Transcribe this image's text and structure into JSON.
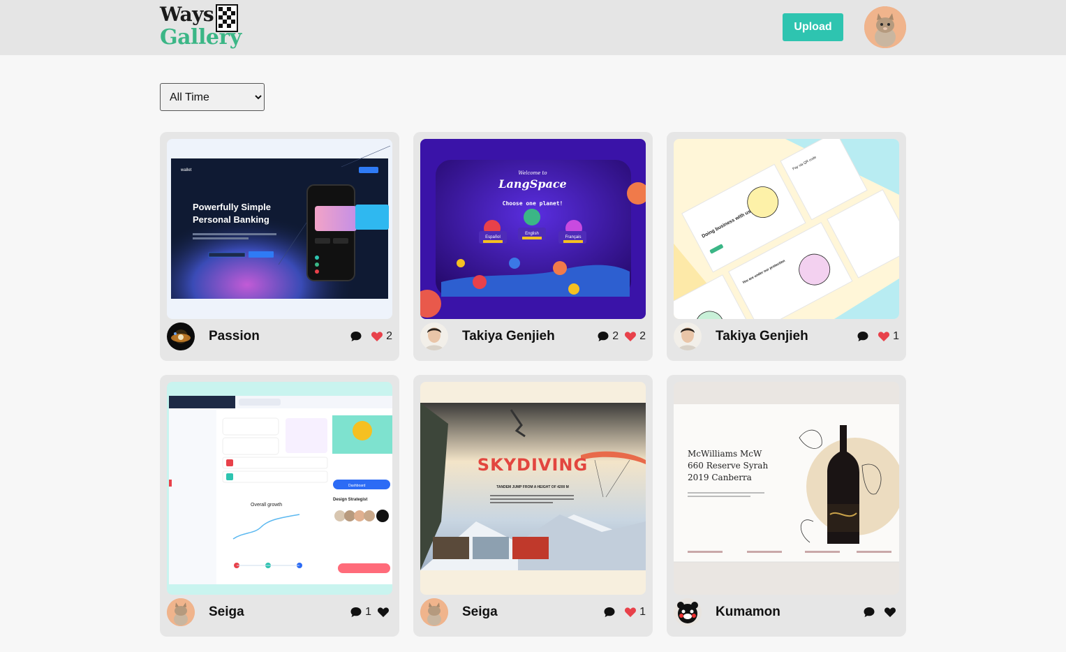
{
  "header": {
    "logo_word1": "Ways",
    "logo_word2": "Gallery",
    "upload_label": "Upload",
    "avatar_icon": "cat-avatar"
  },
  "filter": {
    "selected": "All Time",
    "options": [
      "All Time"
    ]
  },
  "colors": {
    "accent": "#2ec4b0",
    "logo_green": "#3bb686",
    "heart": "#e8414a",
    "card_bg": "#e6e6e6"
  },
  "posts": [
    {
      "author": "Passion",
      "comments": "",
      "likes": "2",
      "liked": true,
      "thumb": {
        "headline1": "Powerfully Simple",
        "headline2": "Personal Banking",
        "brand": "wallet"
      }
    },
    {
      "author": "Takiya Genjieh",
      "comments": "2",
      "likes": "2",
      "liked": true,
      "thumb": {
        "welcome": "Welcome to",
        "title": "LangSpace",
        "subtitle": "Choose one planet!",
        "opt1": "Español",
        "opt2": "English",
        "opt3": "Français"
      }
    },
    {
      "author": "Takiya Genjieh",
      "comments": "",
      "likes": "1",
      "liked": true,
      "thumb": {
        "text1": "Doing business with us is profit",
        "text2": "Pay via QR code",
        "text3": "You are under our protection"
      }
    },
    {
      "author": "Seiga",
      "comments": "1",
      "likes": "",
      "liked": false,
      "thumb": {
        "text1": "Overall growth",
        "text2": "Design Strategist",
        "text3": "Dashboard"
      }
    },
    {
      "author": "Seiga",
      "comments": "",
      "likes": "1",
      "liked": true,
      "thumb": {
        "title": "SKYDIVING",
        "subtitle": "TANDEM JUMP FROM A HEIGHT OF 4200 M"
      }
    },
    {
      "author": "Kumamon",
      "comments": "",
      "likes": "",
      "liked": false,
      "thumb": {
        "line1": "McWilliams McW",
        "line2": "660 Reserve Syrah",
        "line3": "2019 Canberra"
      }
    }
  ]
}
